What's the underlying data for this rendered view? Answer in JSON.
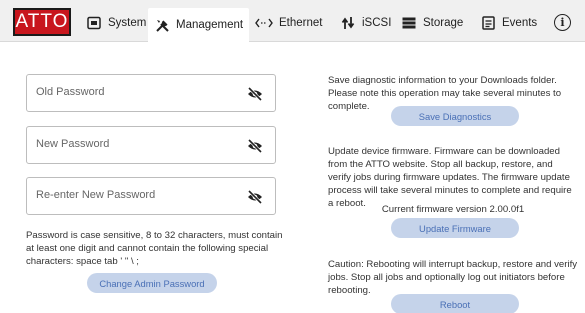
{
  "header": {
    "logo": "ATTO",
    "tabs": [
      {
        "label": "System",
        "icon": "system-icon",
        "active": false
      },
      {
        "label": "Management",
        "icon": "tools-icon",
        "active": true
      },
      {
        "label": "Ethernet",
        "icon": "ethernet-icon",
        "active": false
      },
      {
        "label": "iSCSI",
        "icon": "iscsi-icon",
        "active": false
      },
      {
        "label": "Storage",
        "icon": "storage-icon",
        "active": false
      },
      {
        "label": "Events",
        "icon": "events-icon",
        "active": false
      }
    ],
    "info_icon": "i"
  },
  "password": {
    "old_placeholder": "Old Password",
    "new_placeholder": "New Password",
    "reenter_placeholder": "Re-enter New Password",
    "rules": "Password is case sensitive, 8 to 32 characters, must contain at least one digit and cannot contain the following special characters: space tab ' \" \\ ;",
    "change_button": "Change Admin Password"
  },
  "diagnostics": {
    "text": "Save diagnostic information to your Downloads folder. Please note this operation may take several minutes to complete.",
    "button": "Save Diagnostics"
  },
  "firmware": {
    "text": "Update device firmware. Firmware can be downloaded from the ATTO website. Stop all backup, restore, and verify jobs during firmware updates. The firmware update process will take several minutes to complete and require a reboot.",
    "current": "Current firmware version 2.00.0f1",
    "button": "Update Firmware"
  },
  "reboot": {
    "text": "Caution: Rebooting will interrupt backup, restore and verify jobs. Stop all jobs and optionally log out initiators before rebooting.",
    "button": "Reboot"
  },
  "colors": {
    "logo_bg": "#c8161d",
    "button_bg": "#c5d3ea",
    "button_text": "#4a70b6"
  }
}
